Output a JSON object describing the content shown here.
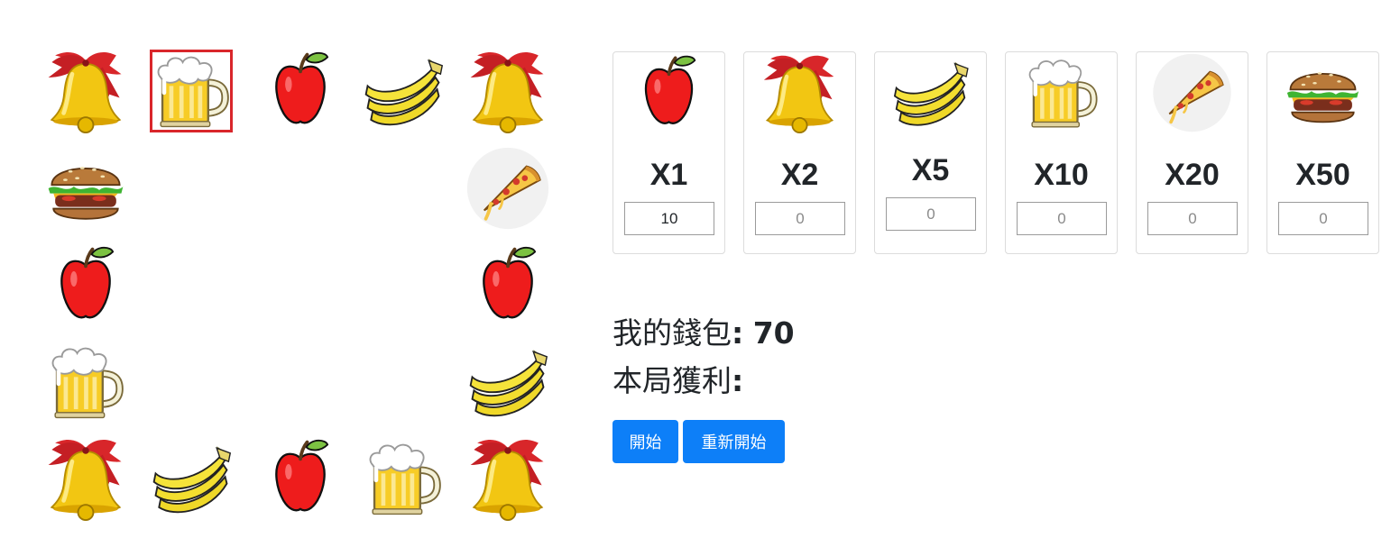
{
  "board": {
    "cells": [
      {
        "row": 0,
        "col": 0,
        "item": "bell"
      },
      {
        "row": 0,
        "col": 1,
        "item": "beer",
        "selected": true
      },
      {
        "row": 0,
        "col": 2,
        "item": "apple"
      },
      {
        "row": 0,
        "col": 3,
        "item": "banana"
      },
      {
        "row": 0,
        "col": 4,
        "item": "bell"
      },
      {
        "row": 1,
        "col": 0,
        "item": "burger"
      },
      {
        "row": 1,
        "col": 4,
        "item": "pizza"
      },
      {
        "row": 2,
        "col": 0,
        "item": "apple"
      },
      {
        "row": 2,
        "col": 4,
        "item": "apple"
      },
      {
        "row": 3,
        "col": 0,
        "item": "beer"
      },
      {
        "row": 3,
        "col": 4,
        "item": "banana"
      },
      {
        "row": 4,
        "col": 0,
        "item": "bell"
      },
      {
        "row": 4,
        "col": 1,
        "item": "banana"
      },
      {
        "row": 4,
        "col": 2,
        "item": "apple"
      },
      {
        "row": 4,
        "col": 3,
        "item": "beer"
      },
      {
        "row": 4,
        "col": 4,
        "item": "bell"
      }
    ]
  },
  "bets": [
    {
      "item": "apple",
      "multiplier": "X1",
      "value": "10",
      "placeholder": "0"
    },
    {
      "item": "bell",
      "multiplier": "X2",
      "value": "",
      "placeholder": "0"
    },
    {
      "item": "banana",
      "multiplier": "X5",
      "value": "",
      "placeholder": "0"
    },
    {
      "item": "beer",
      "multiplier": "X10",
      "value": "",
      "placeholder": "0"
    },
    {
      "item": "pizza",
      "multiplier": "X20",
      "value": "",
      "placeholder": "0"
    },
    {
      "item": "burger",
      "multiplier": "X50",
      "value": "",
      "placeholder": "0"
    }
  ],
  "wallet": {
    "label": "我的錢包",
    "colon": ":",
    "amount": "70"
  },
  "round_profit": {
    "label": "本局獲利",
    "colon": ":",
    "amount": ""
  },
  "buttons": {
    "start": "開始",
    "restart": "重新開始"
  },
  "colors": {
    "button": "#0d7ff8",
    "selected_border": "#d9262b"
  }
}
